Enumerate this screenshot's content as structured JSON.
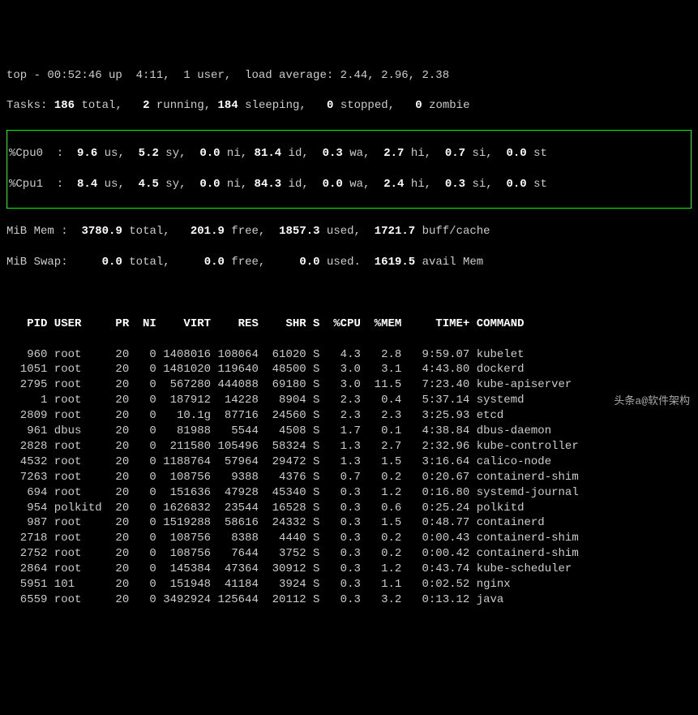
{
  "header": {
    "line1": "top - 00:52:46 up  4:11,  1 user,  load average: 2.44, 2.96, 2.38",
    "tasks_label": "Tasks:",
    "tasks_total": "186",
    "tasks_total_lbl": "total,",
    "tasks_running": "2",
    "tasks_running_lbl": "running,",
    "tasks_sleeping": "184",
    "tasks_sleeping_lbl": "sleeping,",
    "tasks_stopped": "0",
    "tasks_stopped_lbl": "stopped,",
    "tasks_zombie": "0",
    "tasks_zombie_lbl": "zombie",
    "cpu0_label": "%Cpu0  :",
    "cpu0_us": "9.6",
    "cpu0_sy": "5.2",
    "cpu0_ni": "0.0",
    "cpu0_id": "81.4",
    "cpu0_wa": "0.3",
    "cpu0_hi": "2.7",
    "cpu0_si": "0.7",
    "cpu0_st": "0.0",
    "cpu1_label": "%Cpu1  :",
    "cpu1_us": "8.4",
    "cpu1_sy": "4.5",
    "cpu1_ni": "0.0",
    "cpu1_id": "84.3",
    "cpu1_wa": "0.0",
    "cpu1_hi": "2.4",
    "cpu1_si": "0.3",
    "cpu1_st": "0.0",
    "mem_label": "MiB Mem :",
    "mem_total": "3780.9",
    "mem_free": "201.9",
    "mem_used": "1857.3",
    "mem_buff": "1721.7",
    "swap_label": "MiB Swap:",
    "swap_total": "0.0",
    "swap_free": "0.0",
    "swap_used": "0.0",
    "swap_avail": "1619.5"
  },
  "columns": {
    "pid": "PID",
    "user": "USER",
    "pr": "PR",
    "ni": "NI",
    "virt": "VIRT",
    "res": "RES",
    "shr": "SHR",
    "s": "S",
    "cpu": "%CPU",
    "mem": "%MEM",
    "time": "TIME+",
    "command": "COMMAND"
  },
  "rows": [
    {
      "pid": "960",
      "user": "root",
      "pr": "20",
      "ni": "0",
      "virt": "1408016",
      "res": "108064",
      "shr": "61020",
      "s": "S",
      "cpu": "4.3",
      "mem": "2.8",
      "time": "9:59.07",
      "cmd": "kubelet"
    },
    {
      "pid": "1051",
      "user": "root",
      "pr": "20",
      "ni": "0",
      "virt": "1481020",
      "res": "119640",
      "shr": "48500",
      "s": "S",
      "cpu": "3.0",
      "mem": "3.1",
      "time": "4:43.80",
      "cmd": "dockerd"
    },
    {
      "pid": "2795",
      "user": "root",
      "pr": "20",
      "ni": "0",
      "virt": "567280",
      "res": "444088",
      "shr": "69180",
      "s": "S",
      "cpu": "3.0",
      "mem": "11.5",
      "time": "7:23.40",
      "cmd": "kube-apiserver"
    },
    {
      "pid": "1",
      "user": "root",
      "pr": "20",
      "ni": "0",
      "virt": "187912",
      "res": "14228",
      "shr": "8904",
      "s": "S",
      "cpu": "2.3",
      "mem": "0.4",
      "time": "5:37.14",
      "cmd": "systemd"
    },
    {
      "pid": "2809",
      "user": "root",
      "pr": "20",
      "ni": "0",
      "virt": "10.1g",
      "res": "87716",
      "shr": "24560",
      "s": "S",
      "cpu": "2.3",
      "mem": "2.3",
      "time": "3:25.93",
      "cmd": "etcd"
    },
    {
      "pid": "961",
      "user": "dbus",
      "pr": "20",
      "ni": "0",
      "virt": "81988",
      "res": "5544",
      "shr": "4508",
      "s": "S",
      "cpu": "1.7",
      "mem": "0.1",
      "time": "4:38.84",
      "cmd": "dbus-daemon"
    },
    {
      "pid": "2828",
      "user": "root",
      "pr": "20",
      "ni": "0",
      "virt": "211580",
      "res": "105496",
      "shr": "58324",
      "s": "S",
      "cpu": "1.3",
      "mem": "2.7",
      "time": "2:32.96",
      "cmd": "kube-controller"
    },
    {
      "pid": "4532",
      "user": "root",
      "pr": "20",
      "ni": "0",
      "virt": "1188764",
      "res": "57964",
      "shr": "29472",
      "s": "S",
      "cpu": "1.3",
      "mem": "1.5",
      "time": "3:16.64",
      "cmd": "calico-node"
    },
    {
      "pid": "7263",
      "user": "root",
      "pr": "20",
      "ni": "0",
      "virt": "108756",
      "res": "9388",
      "shr": "4376",
      "s": "S",
      "cpu": "0.7",
      "mem": "0.2",
      "time": "0:20.67",
      "cmd": "containerd-shim"
    },
    {
      "pid": "694",
      "user": "root",
      "pr": "20",
      "ni": "0",
      "virt": "151636",
      "res": "47928",
      "shr": "45340",
      "s": "S",
      "cpu": "0.3",
      "mem": "1.2",
      "time": "0:16.80",
      "cmd": "systemd-journal"
    },
    {
      "pid": "954",
      "user": "polkitd",
      "pr": "20",
      "ni": "0",
      "virt": "1626832",
      "res": "23544",
      "shr": "16528",
      "s": "S",
      "cpu": "0.3",
      "mem": "0.6",
      "time": "0:25.24",
      "cmd": "polkitd"
    },
    {
      "pid": "987",
      "user": "root",
      "pr": "20",
      "ni": "0",
      "virt": "1519288",
      "res": "58616",
      "shr": "24332",
      "s": "S",
      "cpu": "0.3",
      "mem": "1.5",
      "time": "0:48.77",
      "cmd": "containerd"
    },
    {
      "pid": "2718",
      "user": "root",
      "pr": "20",
      "ni": "0",
      "virt": "108756",
      "res": "8388",
      "shr": "4440",
      "s": "S",
      "cpu": "0.3",
      "mem": "0.2",
      "time": "0:00.43",
      "cmd": "containerd-shim"
    },
    {
      "pid": "2752",
      "user": "root",
      "pr": "20",
      "ni": "0",
      "virt": "108756",
      "res": "7644",
      "shr": "3752",
      "s": "S",
      "cpu": "0.3",
      "mem": "0.2",
      "time": "0:00.42",
      "cmd": "containerd-shim"
    },
    {
      "pid": "2864",
      "user": "root",
      "pr": "20",
      "ni": "0",
      "virt": "145384",
      "res": "47364",
      "shr": "30912",
      "s": "S",
      "cpu": "0.3",
      "mem": "1.2",
      "time": "0:43.74",
      "cmd": "kube-scheduler"
    },
    {
      "pid": "5951",
      "user": "101",
      "pr": "20",
      "ni": "0",
      "virt": "151948",
      "res": "41184",
      "shr": "3924",
      "s": "S",
      "cpu": "0.3",
      "mem": "1.1",
      "time": "0:02.52",
      "cmd": "nginx"
    },
    {
      "pid": "6559",
      "user": "root",
      "pr": "20",
      "ni": "0",
      "virt": "3492924",
      "res": "125644",
      "shr": "20112",
      "s": "S",
      "cpu": "0.3",
      "mem": "3.2",
      "time": "0:13.12",
      "cmd": "java"
    }
  ],
  "watermark": "头条a@软件架构"
}
